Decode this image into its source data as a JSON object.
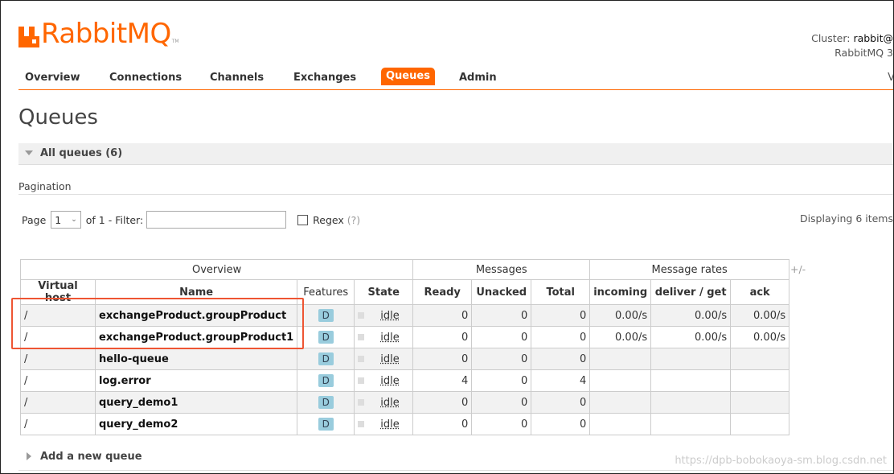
{
  "app": {
    "logo_text": "RabbitMQ",
    "logo_tm": "TM"
  },
  "cluster": {
    "label": "Cluster:",
    "name": "rabbit@",
    "version": "RabbitMQ 3"
  },
  "nav": {
    "items": [
      {
        "label": "Overview"
      },
      {
        "label": "Connections"
      },
      {
        "label": "Channels"
      },
      {
        "label": "Exchanges"
      },
      {
        "label": "Queues",
        "active": true
      },
      {
        "label": "Admin"
      }
    ],
    "right": "V"
  },
  "page": {
    "title": "Queues"
  },
  "section": {
    "label": "All queues (6)"
  },
  "pagination": {
    "label": "Pagination",
    "page_prefix": "Page",
    "page_value": "1",
    "of_text": "of 1",
    "filter_label": "- Filter:",
    "filter_value": "",
    "regex_label": "Regex",
    "regex_help": "(?)",
    "displaying": "Displaying 6 items"
  },
  "table": {
    "groups": [
      "Overview",
      "Messages",
      "Message rates"
    ],
    "columns": [
      "Virtual host",
      "Name",
      "Features",
      "State",
      "Ready",
      "Unacked",
      "Total",
      "incoming",
      "deliver / get",
      "ack"
    ],
    "plus_minus": "+/-",
    "rows": [
      {
        "vhost": "/",
        "name": "exchangeProduct.groupProduct",
        "feature": "D",
        "state": "idle",
        "ready": "0",
        "unacked": "0",
        "total": "0",
        "incoming": "0.00/s",
        "deliver": "0.00/s",
        "ack": "0.00/s"
      },
      {
        "vhost": "/",
        "name": "exchangeProduct.groupProduct1",
        "feature": "D",
        "state": "idle",
        "ready": "0",
        "unacked": "0",
        "total": "0",
        "incoming": "0.00/s",
        "deliver": "0.00/s",
        "ack": "0.00/s"
      },
      {
        "vhost": "/",
        "name": "hello-queue",
        "feature": "D",
        "state": "idle",
        "ready": "0",
        "unacked": "0",
        "total": "0",
        "incoming": "",
        "deliver": "",
        "ack": ""
      },
      {
        "vhost": "/",
        "name": "log.error",
        "feature": "D",
        "state": "idle",
        "ready": "4",
        "unacked": "0",
        "total": "4",
        "incoming": "",
        "deliver": "",
        "ack": ""
      },
      {
        "vhost": "/",
        "name": "query_demo1",
        "feature": "D",
        "state": "idle",
        "ready": "0",
        "unacked": "0",
        "total": "0",
        "incoming": "",
        "deliver": "",
        "ack": ""
      },
      {
        "vhost": "/",
        "name": "query_demo2",
        "feature": "D",
        "state": "idle",
        "ready": "0",
        "unacked": "0",
        "total": "0",
        "incoming": "",
        "deliver": "",
        "ack": ""
      }
    ]
  },
  "add_queue": {
    "label": "Add a new queue"
  },
  "watermark": "https://dpb-bobokaoya-sm.blog.csdn.net",
  "colors": {
    "brand": "#ff6600",
    "highlight": "#e53322",
    "badge": "#99ccdd"
  }
}
